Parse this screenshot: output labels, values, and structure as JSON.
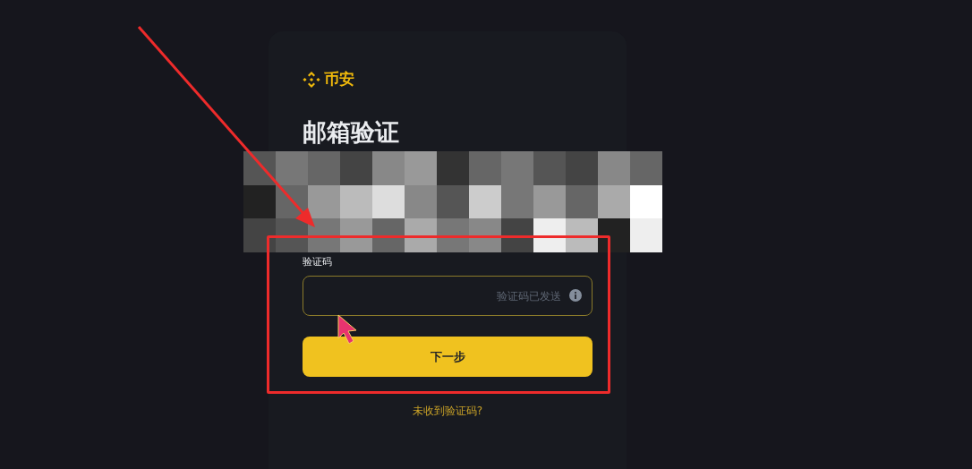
{
  "brand": {
    "name": "币安"
  },
  "title": "邮箱验证",
  "code_field": {
    "label": "验证码",
    "placeholder": "验证码已发送"
  },
  "next_button": {
    "label": "下一步"
  },
  "resend_link": {
    "label": "未收到验证码?"
  }
}
